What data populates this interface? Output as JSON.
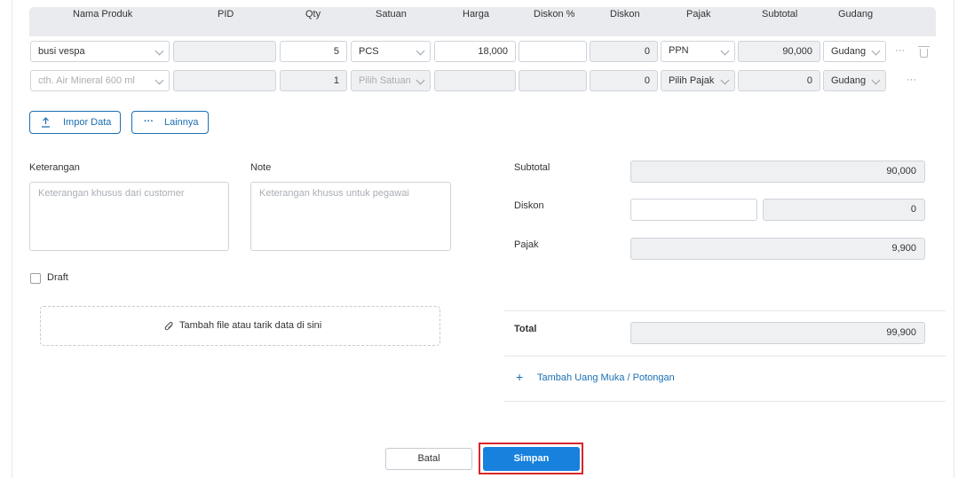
{
  "table": {
    "headers": [
      "Nama Produk",
      "PID",
      "Qty",
      "Satuan",
      "Harga",
      "Diskon %",
      "Diskon",
      "Pajak",
      "Subtotal",
      "Gudang"
    ],
    "rows": [
      {
        "product": "busi vespa",
        "pid": "",
        "qty": "5",
        "unit": "PCS",
        "price": "18,000",
        "disc_pct": "",
        "disc": "0",
        "tax": "PPN",
        "subtotal": "90,000",
        "warehouse": "Gudang"
      },
      {
        "product_placeholder": "cth. Air Mineral 600 ml",
        "pid": "",
        "qty": "1",
        "unit_placeholder": "Pilih Satuan",
        "price": "",
        "disc_pct": "",
        "disc": "0",
        "tax_placeholder": "Pilih Pajak",
        "subtotal": "0",
        "warehouse": "Gudang"
      }
    ],
    "more_glyph": "···"
  },
  "actions": {
    "import_label": "Impor Data",
    "more_label": "Lainnya"
  },
  "notes": {
    "keterangan_label": "Keterangan",
    "keterangan_placeholder": "Keterangan khusus dari customer",
    "note_label": "Note",
    "note_placeholder": "Keterangan khusus untuk pegawai",
    "draft_label": "Draft",
    "dropzone_text": "Tambah file atau tarik data di sini"
  },
  "summary": {
    "subtotal_label": "Subtotal",
    "subtotal_value": "90,000",
    "discount_label": "Diskon",
    "discount_value": "0",
    "tax_label": "Pajak",
    "tax_value": "9,900",
    "total_label": "Total",
    "total_value": "99,900",
    "add_link": "Tambah Uang Muka / Potongan"
  },
  "footer": {
    "cancel_label": "Batal",
    "save_label": "Simpan"
  },
  "colors": {
    "accent": "#1781dd",
    "link": "#1b6fb3",
    "highlight": "#d8262b"
  }
}
